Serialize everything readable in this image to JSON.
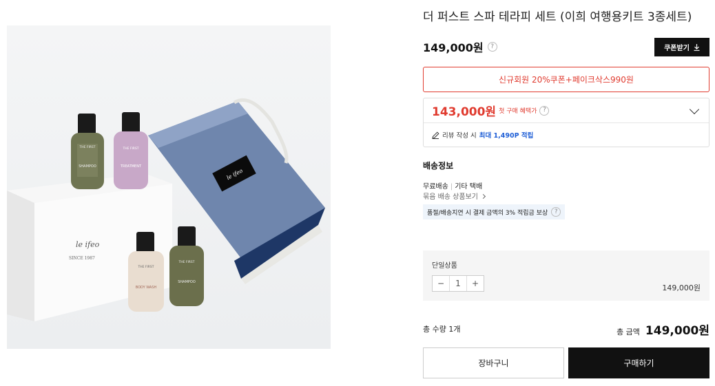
{
  "product": {
    "title": "더 퍼스트 스파 테라피 세트 (이희 여행용키트 3종세트)",
    "price": "149,000원",
    "price_help": "?"
  },
  "image_text": {
    "box_logo": "le ifeo",
    "box_since": "SINCE 1987",
    "pouch_logo": "le ifeo",
    "bottle_brand": "THE FIRST",
    "bottle_1": "SHAMPOO",
    "bottle_2": "TREATMENT",
    "bottle_3": "BODY WASH",
    "bottle_4": "SHAMPOO"
  },
  "coupon_button": {
    "label": "쿠폰받기",
    "icon": "download-icon"
  },
  "promo_banner": "신규회원 20%쿠폰+페이크삭스990원",
  "benefit": {
    "price": "143,000원",
    "sub": "첫 구매 혜택가",
    "help": "?",
    "review_prefix": "리뷰 작성 시",
    "review_highlight": "최대 1,490P 적립"
  },
  "shipping": {
    "title": "배송정보",
    "method": "무료배송",
    "separator": "|",
    "carrier": "기타 택배",
    "bundle_link": "묶음 배송 상품보기",
    "guarantee": "품절/배송지연 시 결제 금액의 3% 적립금 보상",
    "guarantee_help": "?"
  },
  "option": {
    "label": "단일상품",
    "minus": "−",
    "quantity": "1",
    "plus": "+",
    "price": "149,000원"
  },
  "total": {
    "quantity_label": "총 수량 1개",
    "amount_label": "총 금액",
    "amount": "149,000원"
  },
  "buttons": {
    "cart": "장바구니",
    "buy": "구매하기"
  },
  "colors": {
    "accent_red": "#e03b2f",
    "link_blue": "#1f5fd6",
    "dark": "#111111"
  }
}
